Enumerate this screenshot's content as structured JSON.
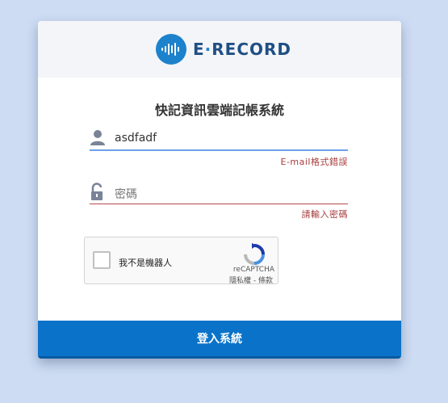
{
  "brand": {
    "name_prefix": "E",
    "name_dot": "·",
    "name_suffix": "RECORD",
    "color": "#1d82cc",
    "text_color": "#1f4f86"
  },
  "form": {
    "title": "快記資訊雲端記帳系統",
    "email": {
      "value": "asdfadf",
      "error": "E-mail格式錯誤",
      "icon": "user-icon"
    },
    "password": {
      "placeholder": "密碼",
      "error": "請輸入密碼",
      "icon": "unlock-icon"
    },
    "submit_label": "登入系統"
  },
  "captcha": {
    "label": "我不是機器人",
    "brand": "reCAPTCHA",
    "terms": "隱私權 - 條款"
  },
  "colors": {
    "background": "#cddcf3",
    "button": "#0a73c9",
    "error": "#a83d3d",
    "focus_underline": "#6aa0ea"
  }
}
